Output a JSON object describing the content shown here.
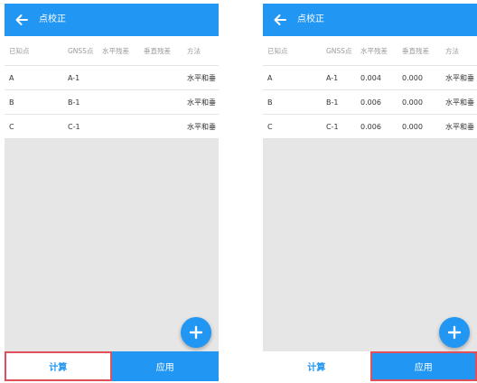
{
  "left": {
    "title": "点校正",
    "headers": [
      "已知点",
      "GNSS点",
      "水平残差",
      "垂直残差",
      "方法"
    ],
    "rows": [
      {
        "known": "A",
        "gnss": "A-1",
        "hres": "",
        "vres": "",
        "method": "水平和垂"
      },
      {
        "known": "B",
        "gnss": "B-1",
        "hres": "",
        "vres": "",
        "method": "水平和垂"
      },
      {
        "known": "C",
        "gnss": "C-1",
        "hres": "",
        "vres": "",
        "method": "水平和垂"
      }
    ],
    "calc_label": "计算",
    "apply_label": "应用"
  },
  "right": {
    "title": "点校正",
    "headers": [
      "已知点",
      "GNSS点",
      "水平残差",
      "垂直残差",
      "方法"
    ],
    "rows": [
      {
        "known": "A",
        "gnss": "A-1",
        "hres": "0.004",
        "vres": "0.000",
        "method": "水平和垂"
      },
      {
        "known": "B",
        "gnss": "B-1",
        "hres": "0.006",
        "vres": "0.000",
        "method": "水平和垂"
      },
      {
        "known": "C",
        "gnss": "C-1",
        "hres": "0.006",
        "vres": "0.000",
        "method": "水平和垂"
      }
    ],
    "calc_label": "计算",
    "apply_label": "应用"
  },
  "colors": {
    "accent": "#2196f3",
    "highlight": "#e0505a"
  },
  "icons": {
    "back": "arrow-left-icon",
    "add": "plus-icon"
  }
}
